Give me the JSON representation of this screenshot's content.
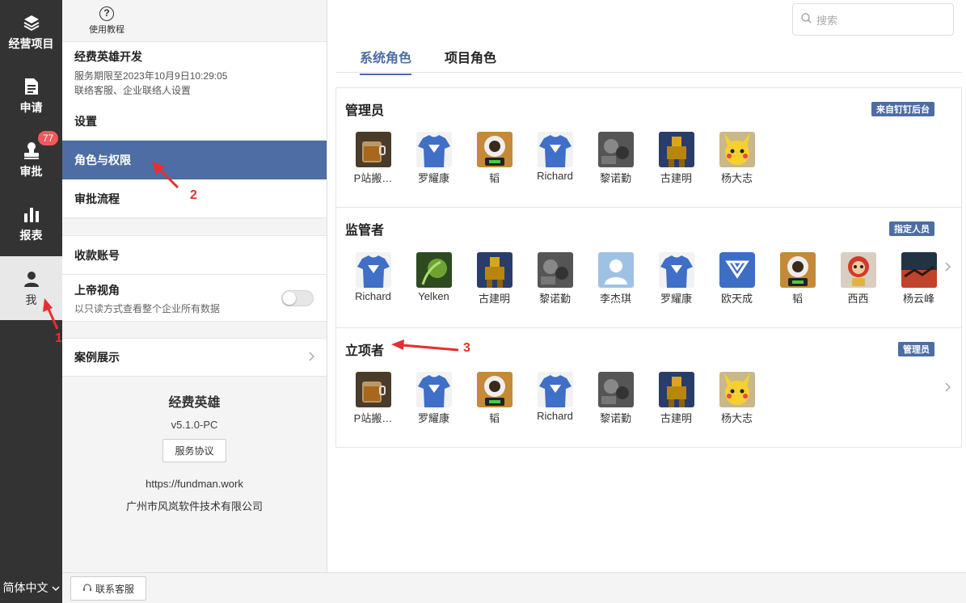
{
  "nav": {
    "items": [
      {
        "label": "经营项目",
        "icon": "layers-icon"
      },
      {
        "label": "申请",
        "icon": "document-icon"
      },
      {
        "label": "审批",
        "icon": "stamp-icon",
        "badge": "77"
      },
      {
        "label": "报表",
        "icon": "bar-chart-icon"
      },
      {
        "label": "我",
        "icon": "user-icon",
        "active": true
      }
    ],
    "language": "简体中文"
  },
  "middle": {
    "tutorial": "使用教程",
    "company": {
      "name": "经费英雄开发",
      "expiry": "服务期限至2023年10月9日10:29:05",
      "contact": "联络客服、企业联络人设置"
    },
    "menu": {
      "settings": "设置",
      "roles": "角色与权限",
      "approval_flow": "审批流程",
      "payment_account": "收款账号",
      "god_view": "上帝视角",
      "god_view_desc": "以只读方式查看整个企业所有数据",
      "cases": "案例展示"
    },
    "about": {
      "name": "经费英雄",
      "version": "v5.1.0-PC",
      "agreement": "服务协议",
      "url": "https://fundman.work",
      "company": "广州市风岚软件技术有限公司"
    }
  },
  "bottom": {
    "support": "联系客服"
  },
  "right": {
    "search_placeholder": "搜索",
    "tabs": [
      "系统角色",
      "项目角色"
    ],
    "sections": [
      {
        "title": "管理员",
        "tag": "来自钉钉后台",
        "members": [
          {
            "name": "P站搬…",
            "avatar": "tea"
          },
          {
            "name": "罗耀康",
            "avatar": "shirt"
          },
          {
            "name": "韬",
            "avatar": "coffee"
          },
          {
            "name": "Richard",
            "avatar": "shirt"
          },
          {
            "name": "黎诺勤",
            "avatar": "gray"
          },
          {
            "name": "古建明",
            "avatar": "robot"
          },
          {
            "name": "杨大志",
            "avatar": "pika"
          }
        ]
      },
      {
        "title": "监管者",
        "tag": "指定人员",
        "members": [
          {
            "name": "Richard",
            "avatar": "shirt"
          },
          {
            "name": "Yelken",
            "avatar": "green"
          },
          {
            "name": "古建明",
            "avatar": "robot"
          },
          {
            "name": "黎诺勤",
            "avatar": "gray"
          },
          {
            "name": "李杰琪",
            "avatar": "default"
          },
          {
            "name": "罗耀康",
            "avatar": "shirt"
          },
          {
            "name": "欧天成",
            "avatar": "logo"
          },
          {
            "name": "韬",
            "avatar": "coffee"
          },
          {
            "name": "西西",
            "avatar": "lion"
          },
          {
            "name": "杨云峰",
            "avatar": "sunset"
          }
        ]
      },
      {
        "title": "立项者",
        "tag": "管理员",
        "members": [
          {
            "name": "P站搬…",
            "avatar": "tea"
          },
          {
            "name": "罗耀康",
            "avatar": "shirt"
          },
          {
            "name": "韬",
            "avatar": "coffee"
          },
          {
            "name": "Richard",
            "avatar": "shirt"
          },
          {
            "name": "黎诺勤",
            "avatar": "gray"
          },
          {
            "name": "古建明",
            "avatar": "robot"
          },
          {
            "name": "杨大志",
            "avatar": "pika"
          }
        ]
      }
    ]
  },
  "annotations": [
    "1",
    "2",
    "3"
  ],
  "colors": {
    "accent": "#4d6da4",
    "nav_bg": "#333333",
    "badge": "#f0585b",
    "annotation": "#e53030"
  }
}
